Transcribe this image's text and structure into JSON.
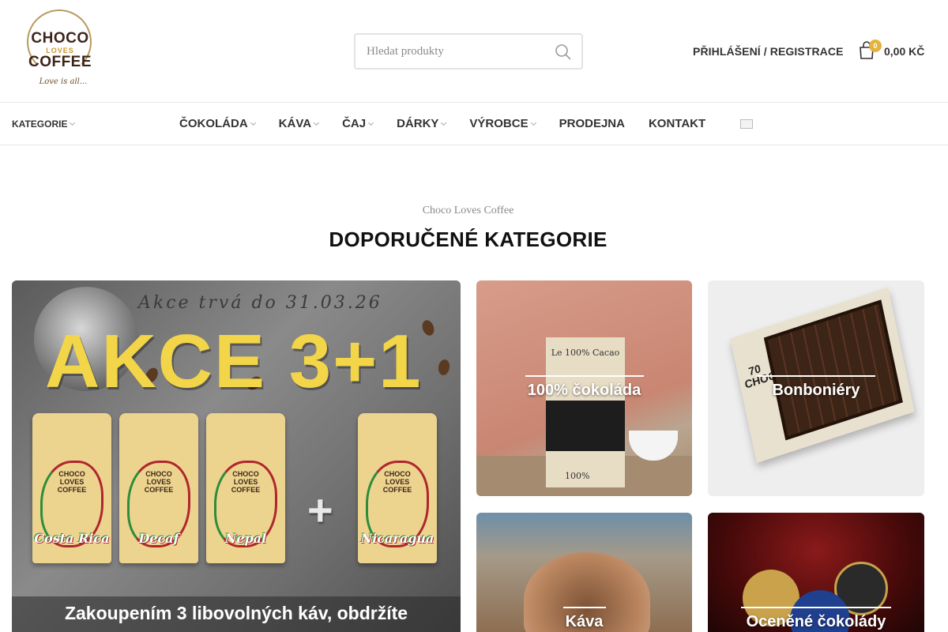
{
  "brand": {
    "logo_line1": "CHOCO",
    "logo_line2": "LOVES",
    "logo_line3": "COFFEE",
    "logo_tagline": "Love is all...",
    "accent_color": "#c7962e",
    "brown_color": "#3d2418"
  },
  "search": {
    "placeholder": "Hledat produkty",
    "icon": "search-icon"
  },
  "account": {
    "login_label": "PŘIHLÁŠENÍ / REGISTRACE"
  },
  "cart": {
    "icon": "cart-icon",
    "count": "0",
    "total": "0,00 KČ",
    "badge_color": "#e3b33c"
  },
  "nav": {
    "categories_label": "KATEGORIE",
    "items": [
      {
        "label": "ČOKOLÁDA",
        "has_dropdown": true
      },
      {
        "label": "KÁVA",
        "has_dropdown": true
      },
      {
        "label": "ČAJ",
        "has_dropdown": true
      },
      {
        "label": "DÁRKY",
        "has_dropdown": true
      },
      {
        "label": "VÝROBCE",
        "has_dropdown": true
      },
      {
        "label": "PRODEJNA",
        "has_dropdown": false
      },
      {
        "label": "KONTAKT",
        "has_dropdown": false
      }
    ],
    "language_icon": "flag-icon"
  },
  "section": {
    "subtitle": "Choco Loves Coffee",
    "title": "DOPORUČENÉ KATEGORIE"
  },
  "promo": {
    "date_text": "Akce trvá do 31.03.26",
    "headline": "AKCE 3+1",
    "bags": [
      "Costa Rica",
      "Decaf",
      "Nepal",
      "Nicaragua"
    ],
    "bag_brand_line1": "CHOCO",
    "bag_brand_line2": "LOVES",
    "bag_brand_line3": "COFFEE",
    "plus": "+",
    "caption": "Zakoupením 3 libovolných káv, obdržíte"
  },
  "categories": [
    {
      "label": "100% čokoláda",
      "pack_text": "Le 100% Cacao",
      "pack_percent": "100%"
    },
    {
      "label": "Bonboniéry",
      "box_text": "70 CHOCOLATS"
    },
    {
      "label": "Káva"
    },
    {
      "label": "Oceněné čokolády"
    }
  ]
}
